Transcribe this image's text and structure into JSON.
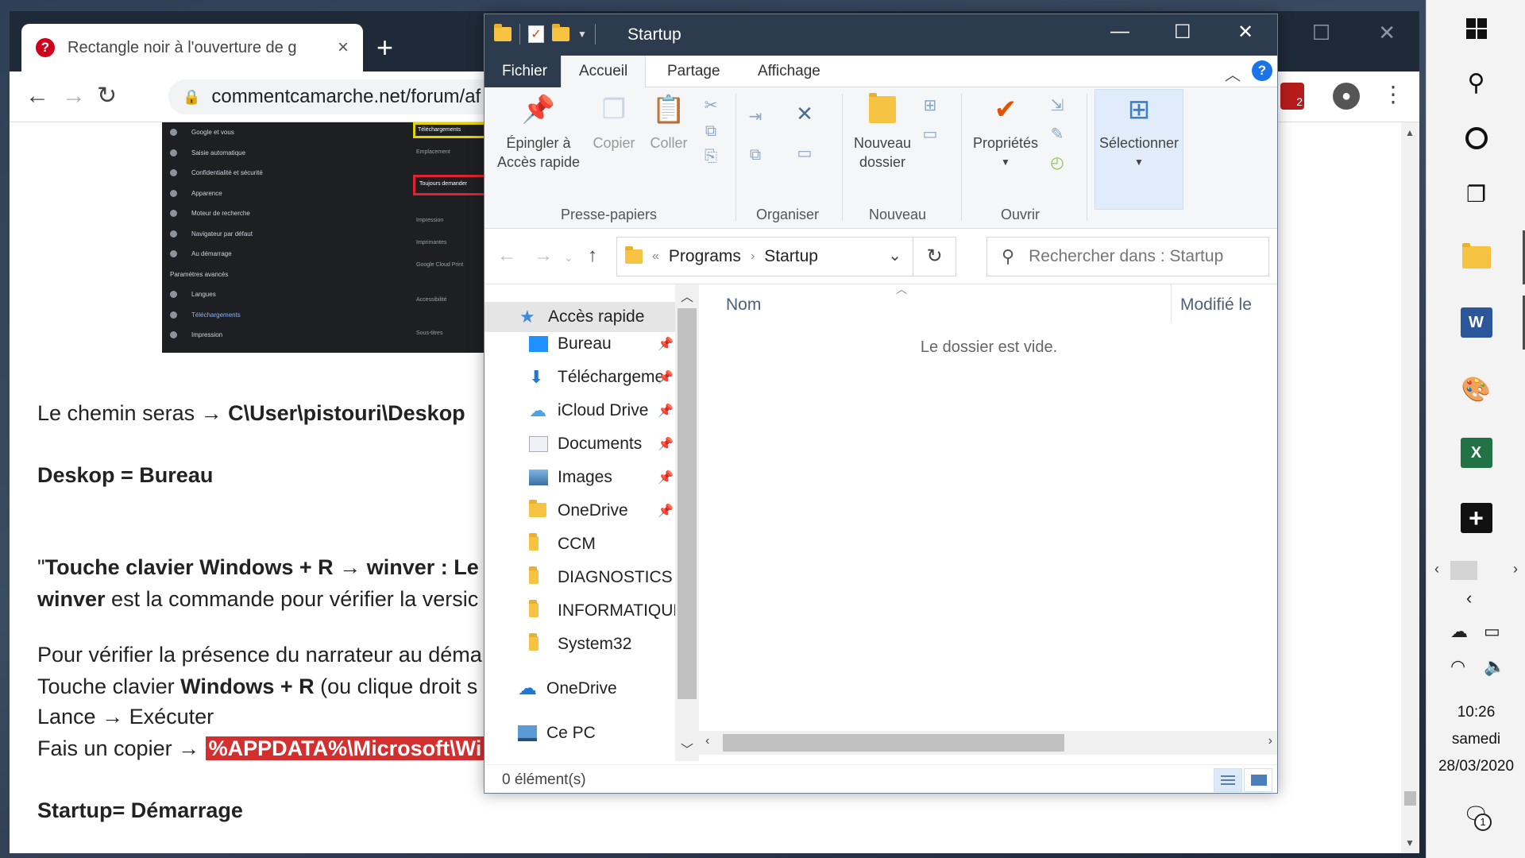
{
  "browser": {
    "tab_title": "Rectangle noir à l'ouverture de g",
    "tab_close": "×",
    "new_tab": "+",
    "url": "commentcamarche.net/forum/af",
    "extension_badge_count": "2"
  },
  "screenshot_embedded": {
    "items": [
      "Saisie automatique",
      "Confidentialité et sécurité",
      "Apparence",
      "Moteur de recherche",
      "Navigateur par défaut",
      "Au démarrage",
      "Paramètres avancés",
      "Langues",
      "Téléchargements",
      "Impression"
    ],
    "top_item": "Google et vous",
    "right_header": "Téléchargements",
    "right_location": "Emplacement",
    "right_ask": "Toujours demander",
    "right_print": "Impression",
    "right_printers": "Imprimantes",
    "right_gcp": "Google Cloud Print",
    "right_access": "Accessibilité",
    "right_subtitles": "Sous-titres"
  },
  "article": {
    "line1_pre": "Le chemin seras → ",
    "line1_bold": "C\\User\\pistouri\\Deskop",
    "line2": "Deskop = Bureau",
    "line3_quote": "\"",
    "line3_bold1": "Touche clavier Windows + R",
    "line3_mid": " → ",
    "line3_bold2": "winver : Le ra",
    "line4_bold": "winver",
    "line4_rest": " est la commande pour vérifier la versic",
    "line5": "Pour vérifier la présence du narrateur au déma",
    "line6_pre": "Touche clavier ",
    "line6_bold": "Windows + R",
    "line6_rest": " (ou clique droit s",
    "line7": "Lance → Exécuter",
    "line8_pre": "Fais un copier → ",
    "line8_mark": "%APPDATA%\\Microsoft\\Wi",
    "line9": "Startup= Démarrage"
  },
  "explorer": {
    "title": "Startup",
    "tabs": [
      "Fichier",
      "Accueil",
      "Partage",
      "Affichage"
    ],
    "ribbon": {
      "pin_label": "Épingler à\nAccès rapide",
      "pin_l1": "Épingler à",
      "pin_l2": "Accès rapide",
      "copy": "Copier",
      "paste": "Coller",
      "group_clipboard": "Presse-papiers",
      "group_organize": "Organiser",
      "new_folder_l1": "Nouveau",
      "new_folder_l2": "dossier",
      "group_new": "Nouveau",
      "properties": "Propriétés",
      "group_open": "Ouvrir",
      "select": "Sélectionner"
    },
    "breadcrumb": [
      "Programs",
      "Startup"
    ],
    "breadcrumb_prefix": "«",
    "search_placeholder": "Rechercher dans : Startup",
    "nav": {
      "quick_access": "Accès rapide",
      "items": [
        "Bureau",
        "Téléchargeme",
        "iCloud Drive",
        "Documents",
        "Images",
        "OneDrive",
        "CCM",
        "DIAGNOSTICS TI",
        "INFORMATIQUE",
        "System32"
      ],
      "onedrive": "OneDrive",
      "this_pc": "Ce PC"
    },
    "columns": [
      "Nom",
      "Modifié le"
    ],
    "empty_message": "Le dossier est vide.",
    "status": "0 élément(s)"
  },
  "taskbar": {
    "time": "10:26",
    "day": "samedi",
    "date": "28/03/2020",
    "notification_count": "1",
    "word_letter": "W",
    "excel_letter": "X"
  },
  "colors": {
    "explorer_title_bg": "#2d3b4e",
    "highlight_red": "#d32f2f",
    "folder_yellow": "#f6c342"
  }
}
